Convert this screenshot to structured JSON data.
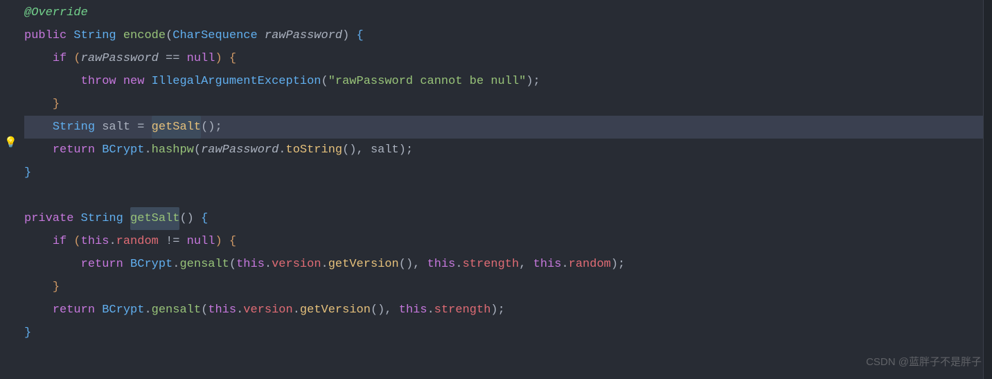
{
  "code": {
    "annotation": "@Override",
    "kw_public": "public",
    "kw_private": "private",
    "kw_if": "if",
    "kw_throw": "throw",
    "kw_new": "new",
    "kw_return": "return",
    "kw_this": "this",
    "kw_null": "null",
    "type_string": "String",
    "type_charsequence": "CharSequence",
    "type_bcrypt": "BCrypt",
    "type_exception": "IllegalArgumentException",
    "method_encode": "encode",
    "method_getsalt": "getSalt",
    "method_hashpw": "hashpw",
    "method_tostring": "toString",
    "method_gensalt": "gensalt",
    "method_getversion": "getVersion",
    "param_rawpassword": "rawPassword",
    "var_salt": "salt",
    "field_random": "random",
    "field_version": "version",
    "field_strength": "strength",
    "string_errmsg": "\"rawPassword cannot be null\"",
    "op_eq": "==",
    "op_neq": "!=",
    "op_assign": "="
  },
  "watermark": "CSDN @蓝胖子不是胖子",
  "bulb_icon": "💡"
}
